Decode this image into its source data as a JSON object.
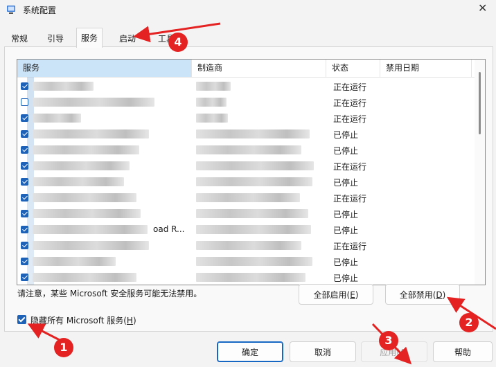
{
  "window": {
    "title": "系统配置"
  },
  "tabs": [
    {
      "label": "常规"
    },
    {
      "label": "引导"
    },
    {
      "label": "服务"
    },
    {
      "label": "启动"
    },
    {
      "label": "工具"
    }
  ],
  "table": {
    "headers": [
      "服务",
      "制造商",
      "状态",
      "禁用日期"
    ],
    "rows": [
      {
        "checked": true,
        "service": "",
        "status": "正在运行"
      },
      {
        "checked": false,
        "service": "",
        "status": "正在运行"
      },
      {
        "checked": true,
        "service": "",
        "status": "正在运行"
      },
      {
        "checked": true,
        "service": "",
        "status": "已停止"
      },
      {
        "checked": true,
        "service": "",
        "status": "已停止"
      },
      {
        "checked": true,
        "service": "",
        "status": "正在运行"
      },
      {
        "checked": true,
        "service": "",
        "status": "已停止"
      },
      {
        "checked": true,
        "service": "",
        "status": "正在运行"
      },
      {
        "checked": true,
        "service": "",
        "status": "已停止"
      },
      {
        "checked": true,
        "service": "oad R...",
        "status": "已停止"
      },
      {
        "checked": true,
        "service": "",
        "status": "正在运行"
      },
      {
        "checked": true,
        "service": "",
        "status": "已停止"
      },
      {
        "checked": true,
        "service": "",
        "status": "已停止"
      }
    ]
  },
  "note": "请注意，某些 Microsoft 安全服务可能无法禁用。",
  "buttons": {
    "enable_all": {
      "text": "全部启用(",
      "key": "E",
      "close": ")"
    },
    "disable_all": {
      "text": "全部禁用(",
      "key": "D",
      "close": ")"
    },
    "ok": "确定",
    "cancel": "取消",
    "apply": {
      "text": "应用(",
      "key": "A",
      "close": ")"
    },
    "help": "帮助"
  },
  "hide_ms": {
    "checked": true,
    "text": "隐藏所有 Microsoft 服务(",
    "key": "H",
    "close": ")"
  },
  "badges": [
    "1",
    "2",
    "3",
    "4"
  ],
  "colors": {
    "accent": "#1d62b6",
    "annotation": "#e52222",
    "header_selected": "#cce4f7"
  }
}
